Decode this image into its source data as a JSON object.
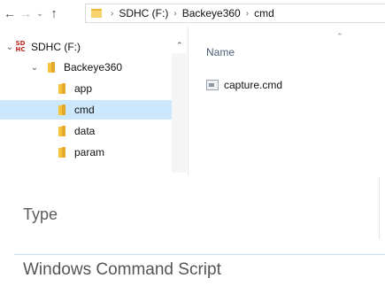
{
  "address_bar": {
    "crumbs": [
      "SDHC (F:)",
      "Backeye360",
      "cmd"
    ]
  },
  "nav_icons": {
    "back": "back-arrow-icon",
    "forward": "forward-arrow-icon",
    "recent": "chevron-down-icon",
    "up": "up-arrow-icon"
  },
  "tree": {
    "drive": {
      "label": "SDHC (F:)",
      "icon_text": "SD HC",
      "icon_color": "#c0261f"
    },
    "root_folder": "Backeye360",
    "children": [
      "app",
      "cmd",
      "data",
      "param"
    ],
    "selected": "cmd",
    "selected_color": "#cce8ff"
  },
  "file_list": {
    "column_name": "Name",
    "files": [
      {
        "name": "capture.cmd",
        "icon": "cmd-file-icon"
      }
    ]
  },
  "details": {
    "label": "Type",
    "value": "Windows Command Script"
  }
}
